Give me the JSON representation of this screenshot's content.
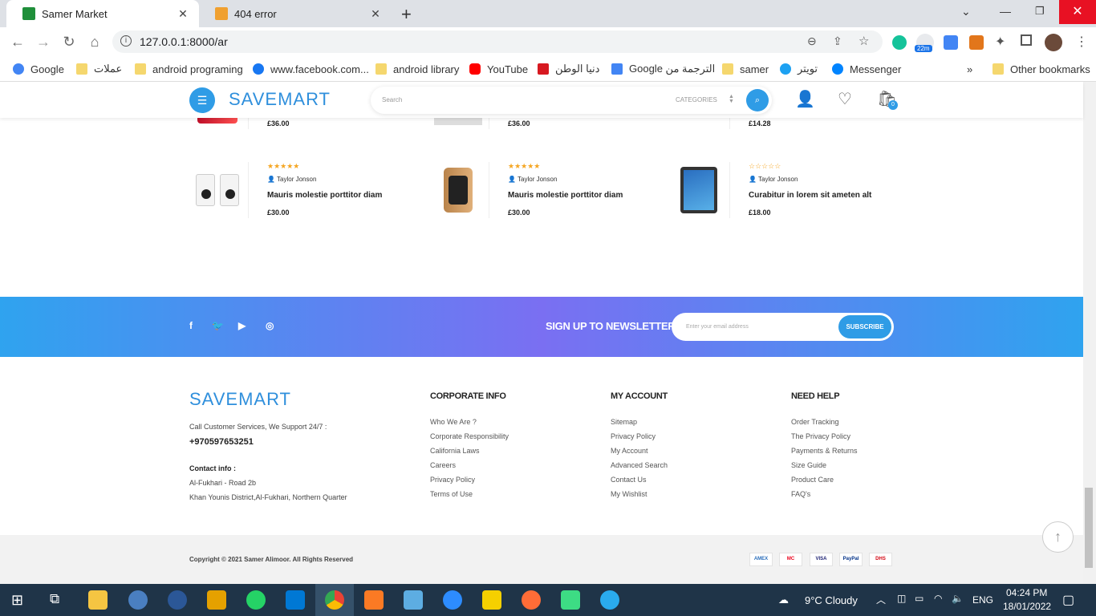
{
  "browser": {
    "tabs": [
      {
        "title": "Samer Market",
        "active": true
      },
      {
        "title": "404 error",
        "active": false
      }
    ],
    "url": "127.0.0.1:8000/ar",
    "extension_badge": "22m",
    "bookmarks": [
      "Google",
      "عملات",
      "android programing",
      "www.facebook.com...",
      "android library",
      "YouTube",
      "دنيا الوطن",
      "Google الترجمة من",
      "samer",
      "تويتر",
      "Messenger"
    ],
    "other_bookmarks": "Other bookmarks"
  },
  "header": {
    "logo": "SAVEMART",
    "search_placeholder": "Search",
    "categories_label": "CATEGORIES",
    "cart_count": "0"
  },
  "products_top": [
    {
      "price": "£36.00"
    },
    {
      "price": "£36.00"
    },
    {
      "price": "£14.28"
    }
  ],
  "products": [
    {
      "stars": "★★★★★",
      "author": "Taylor Jonson",
      "name": "Mauris molestie porttitor diam",
      "price": "£30.00"
    },
    {
      "stars": "★★★★★",
      "author": "Taylor Jonson",
      "name": "Mauris molestie porttitor diam",
      "price": "£30.00"
    },
    {
      "stars": "☆☆☆☆☆",
      "author": "Taylor Jonson",
      "name": "Curabitur in lorem sit ameten alt",
      "price": "£18.00"
    }
  ],
  "newsletter": {
    "title": "SIGN UP TO NEWSLETTER",
    "email_placeholder": "Enter your email address",
    "subscribe_label": "SUBSCRIBE"
  },
  "footer": {
    "logo": "SAVEMART",
    "call_text": "Call Customer Services, We Support 24/7 :",
    "phone": "+970597653251",
    "contact_label": "Contact info :",
    "address1": "Al-Fukhari - Road 2b",
    "address2": "Khan Younis District,Al-Fukhari, Northern Quarter",
    "columns": [
      {
        "title": "CORPORATE INFO",
        "links": [
          "Who We Are ?",
          "Corporate Responsibility",
          "California Laws",
          "Careers",
          "Privacy Policy",
          "Terms of Use"
        ]
      },
      {
        "title": "MY ACCOUNT",
        "links": [
          "Sitemap",
          "Privacy Policy",
          "My Account",
          "Advanced Search",
          "Contact Us",
          "My Wishlist"
        ]
      },
      {
        "title": "NEED HELP",
        "links": [
          "Order Tracking",
          "The Privacy Policy",
          "Payments & Returns",
          "Size Guide",
          "Product Care",
          "FAQ's"
        ]
      }
    ],
    "copyright": "Copyright © 2021 Samer Alimoor. All Rights Reserved",
    "payments": [
      "AMEX",
      "MC",
      "VISA",
      "PayPal",
      "DHS"
    ]
  },
  "taskbar": {
    "weather": "9°C Cloudy",
    "language": "ENG",
    "time": "04:24 PM",
    "date": "18/01/2022"
  },
  "colors": {
    "accent": "#2f9ce6",
    "taskbar": "#1f3448",
    "star": "#f5a623"
  }
}
